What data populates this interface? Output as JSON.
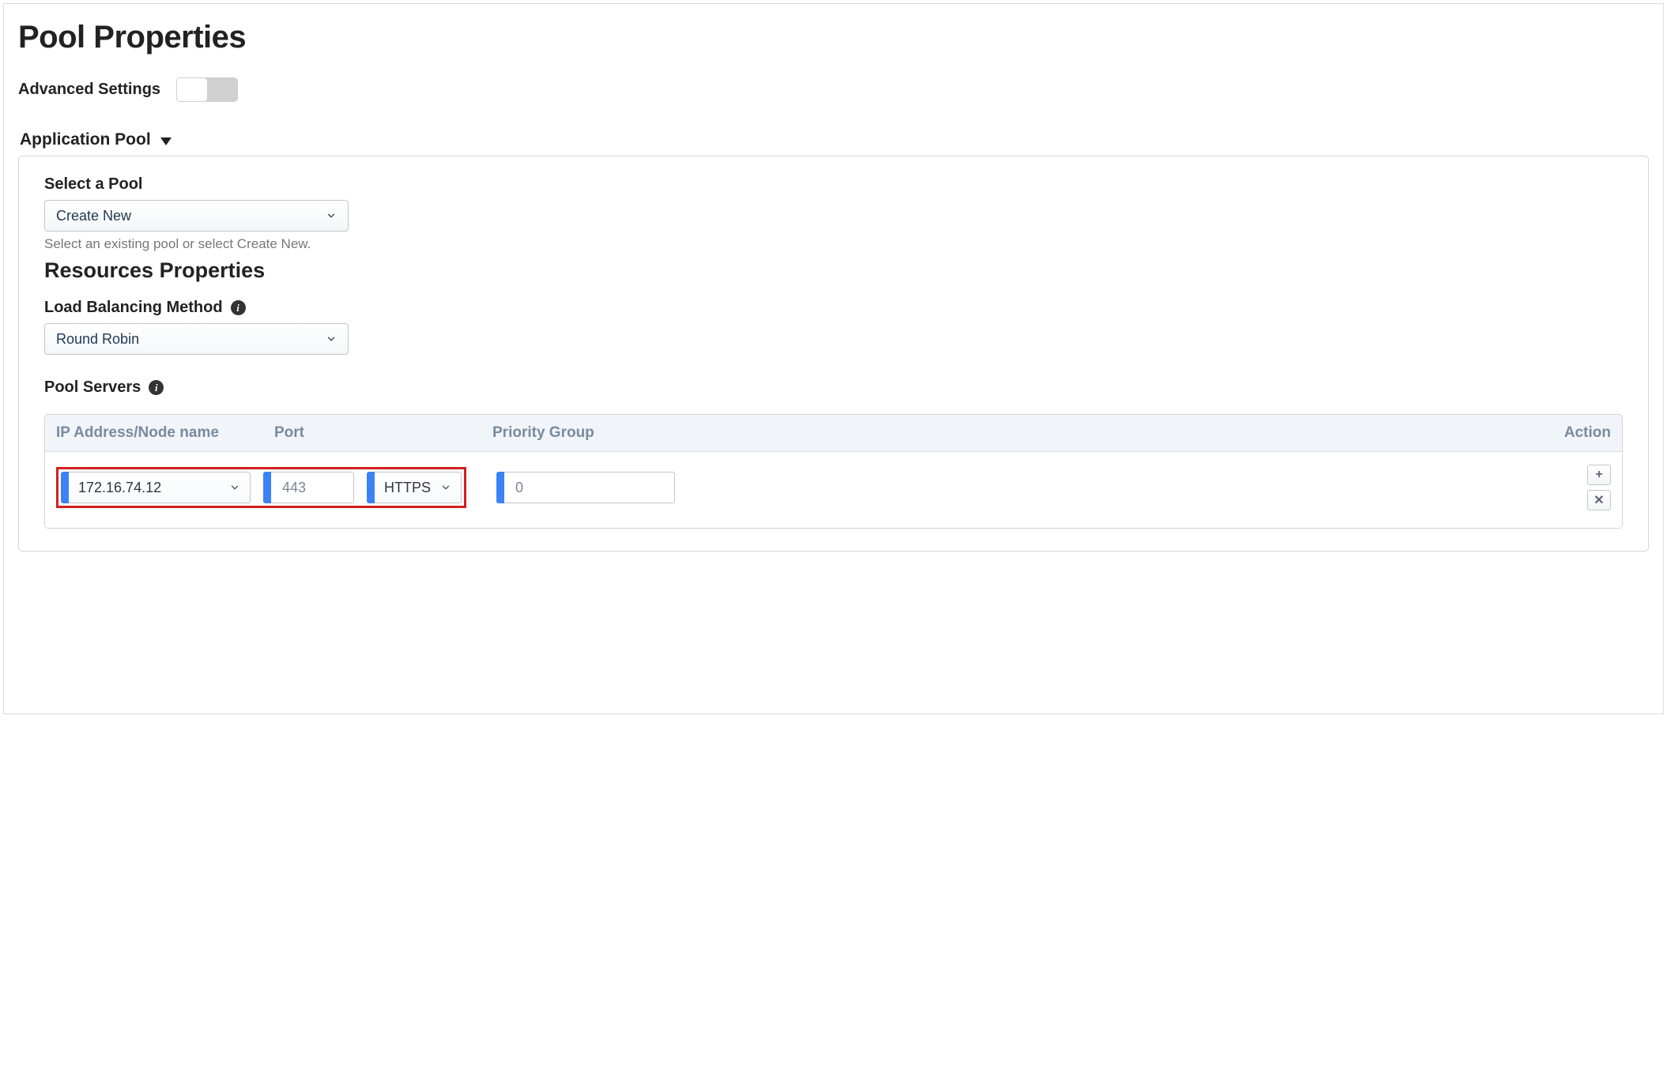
{
  "page": {
    "title": "Pool Properties"
  },
  "advanced": {
    "label": "Advanced Settings",
    "on": false
  },
  "section": {
    "title": "Application Pool"
  },
  "pool_select": {
    "label": "Select a Pool",
    "value": "Create New",
    "hint": "Select an existing pool or select Create New."
  },
  "resources": {
    "heading": "Resources Properties",
    "lb_label": "Load Balancing Method",
    "lb_value": "Round Robin"
  },
  "servers": {
    "label": "Pool Servers",
    "columns": {
      "ip": "IP Address/Node name",
      "port": "Port",
      "pg": "Priority Group",
      "action": "Action"
    },
    "rows": [
      {
        "ip": "172.16.74.12",
        "port": "443",
        "proto": "HTTPS",
        "pg": "0"
      }
    ]
  },
  "icons": {
    "info": "i",
    "plus": "+",
    "close": "✕"
  }
}
